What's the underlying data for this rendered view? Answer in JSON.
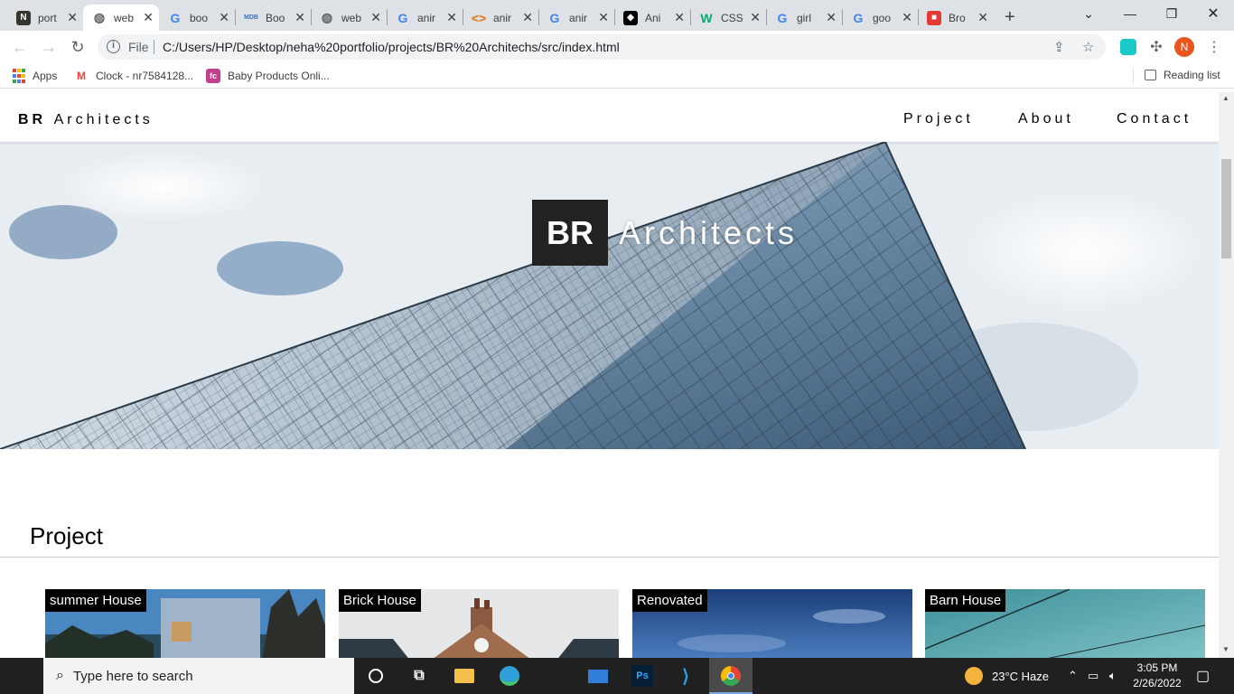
{
  "browser": {
    "tabs": [
      {
        "title": "port",
        "icon": "notion-icon",
        "glyph": "N",
        "color": "#37352f",
        "active": false
      },
      {
        "title": "web",
        "icon": "globe-icon",
        "glyph": "◍",
        "color": "#5f6368",
        "active": true
      },
      {
        "title": "boo",
        "icon": "google-icon",
        "glyph": "G",
        "color": "#4285f4",
        "active": false
      },
      {
        "title": "Boo",
        "icon": "mdb-icon",
        "glyph": "MDB",
        "color": "#3b71ca",
        "active": false
      },
      {
        "title": "web",
        "icon": "globe-icon",
        "glyph": "◍",
        "color": "#5f6368",
        "active": false
      },
      {
        "title": "anir",
        "icon": "google-icon",
        "glyph": "G",
        "color": "#4285f4",
        "active": false
      },
      {
        "title": "anir",
        "icon": "code-icon",
        "glyph": "<>",
        "color": "#e8710a",
        "active": false
      },
      {
        "title": "anir",
        "icon": "google-icon",
        "glyph": "G",
        "color": "#4285f4",
        "active": false
      },
      {
        "title": "Ani",
        "icon": "diamond-icon",
        "glyph": "◆",
        "color": "#000000",
        "active": false
      },
      {
        "title": "CSS",
        "icon": "w3schools-icon",
        "glyph": "W",
        "color": "#04aa6d",
        "active": false
      },
      {
        "title": "girl",
        "icon": "google-icon",
        "glyph": "G",
        "color": "#4285f4",
        "active": false
      },
      {
        "title": "goo",
        "icon": "google-icon",
        "glyph": "G",
        "color": "#4285f4",
        "active": false
      },
      {
        "title": "Bro",
        "icon": "colorful-icon",
        "glyph": "■",
        "color": "#e53935",
        "active": false
      }
    ],
    "new_tab_glyph": "+",
    "window_controls": {
      "dropdown": "⌄",
      "minimize": "—",
      "restore": "❐",
      "close": "✕"
    },
    "address": {
      "info_glyph": "i",
      "scheme_label": "File",
      "url": "C:/Users/HP/Desktop/neha%20portfolio/projects/BR%20Architechs/src/index.html"
    },
    "profile_initial": "N",
    "bookmarks": [
      {
        "label": "Apps",
        "icon": "apps-grid-icon"
      },
      {
        "label": "Clock - nr7584128...",
        "icon": "gmail-icon"
      },
      {
        "label": "Baby Products Onli...",
        "icon": "firstcry-icon"
      }
    ],
    "reading_list": "Reading list"
  },
  "site": {
    "brand_bold": "BR",
    "brand_rest": "Architects",
    "nav": [
      "Project",
      "About",
      "Contact"
    ],
    "hero_box": "BR",
    "hero_rest": "Architects",
    "section_title": "Project",
    "projects": [
      {
        "label": "summer House"
      },
      {
        "label": "Brick House"
      },
      {
        "label": "Renovated"
      },
      {
        "label": "Barn House"
      }
    ]
  },
  "taskbar": {
    "search_placeholder": "Type here to search",
    "weather": "23°C  Haze",
    "time": "3:05 PM",
    "date": "2/26/2022"
  }
}
